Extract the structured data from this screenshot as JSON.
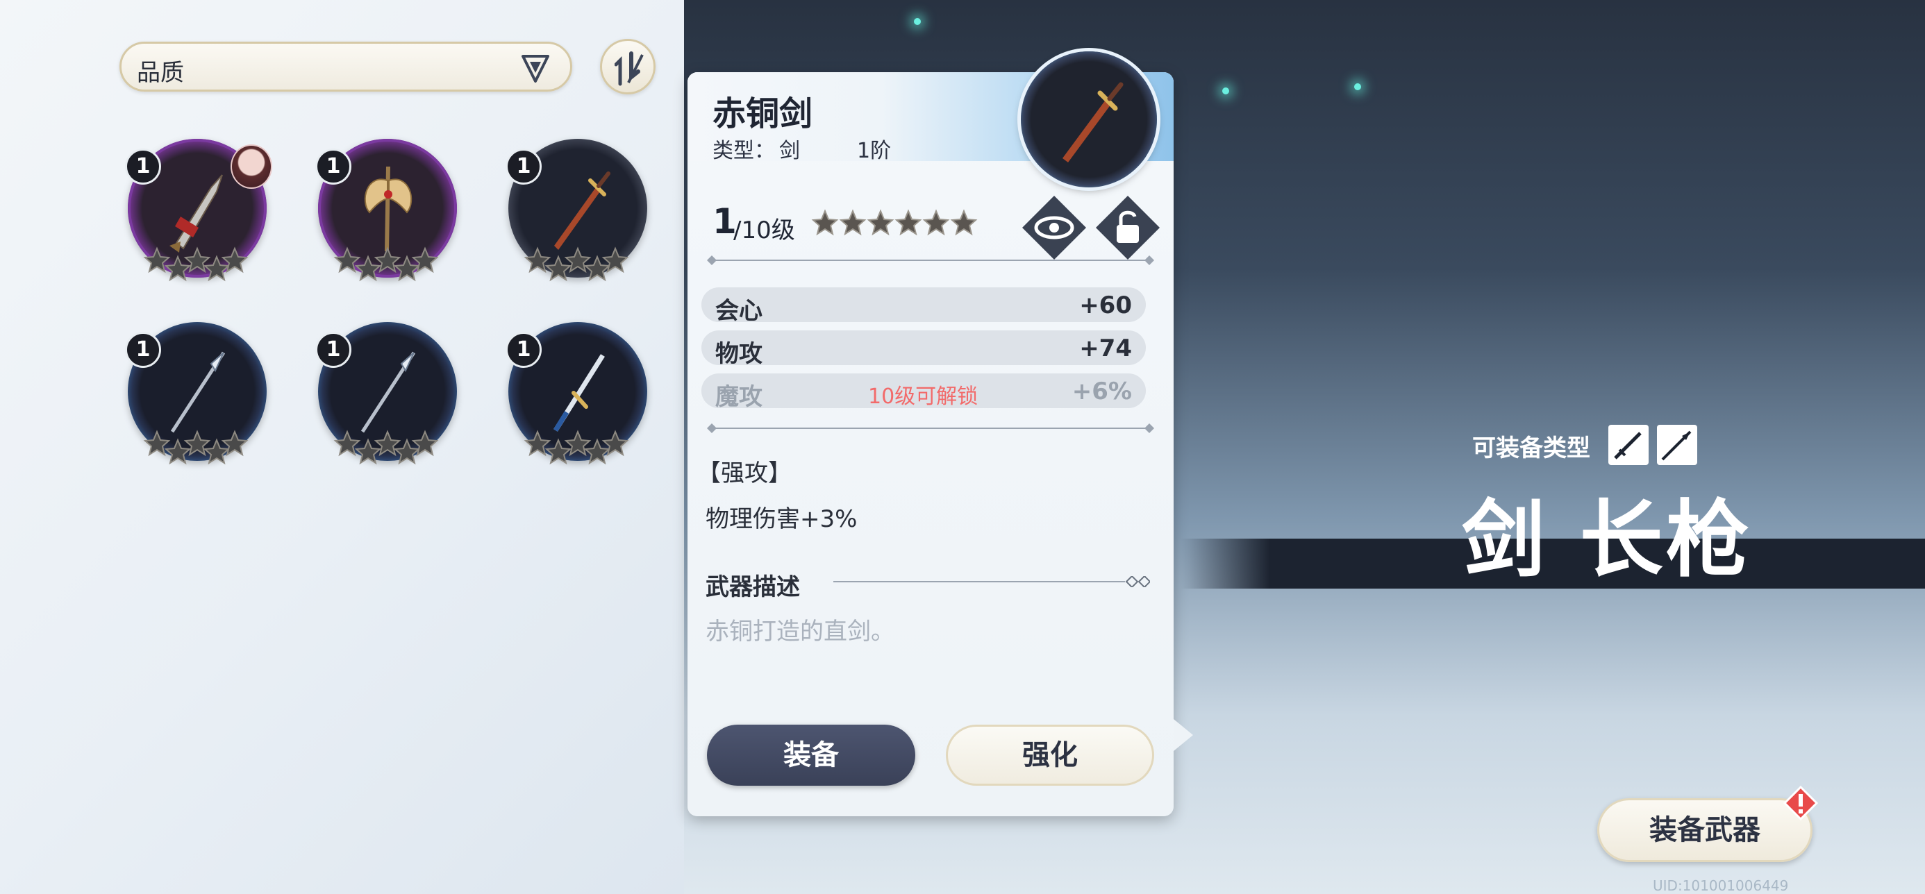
{
  "filter": {
    "label": "品质"
  },
  "inventory": [
    {
      "level": "1",
      "rarity": "purple",
      "equipped_by": true
    },
    {
      "level": "1",
      "rarity": "purple"
    },
    {
      "level": "1",
      "rarity": "white"
    },
    {
      "level": "1",
      "rarity": "blue"
    },
    {
      "level": "1",
      "rarity": "blue"
    },
    {
      "level": "1",
      "rarity": "blue"
    }
  ],
  "detail": {
    "name": "赤铜剑",
    "type_label": "类型：",
    "type_value": "剑",
    "tier": "1阶",
    "level": "1",
    "level_max": "/10级",
    "stars_total": 6,
    "stats": [
      {
        "name": "会心",
        "value": "+60"
      },
      {
        "name": "物攻",
        "value": "+74"
      },
      {
        "name": "魔攻",
        "value": "+6%",
        "note": "10级可解锁",
        "locked": true
      }
    ],
    "passive_title": "【强攻】",
    "passive_desc": "物理伤害+3%",
    "desc_title": "武器描述",
    "desc_text": "赤铜打造的直剑。",
    "equip_label": "装备",
    "upgrade_label": "强化"
  },
  "equip_types": {
    "label": "可装备类型",
    "names": "剑 长枪",
    "icons": [
      "sword-icon",
      "spear-icon"
    ]
  },
  "equip_weapon_label": "装备武器",
  "uid": "UID:101001006449",
  "colors": {
    "accent_dark": "#3a4158",
    "rarity_purple": "#9c3fc4",
    "rarity_blue": "#3f7fc4",
    "locked_note": "#f26a6a",
    "sparkle": "#6bf0e0"
  }
}
